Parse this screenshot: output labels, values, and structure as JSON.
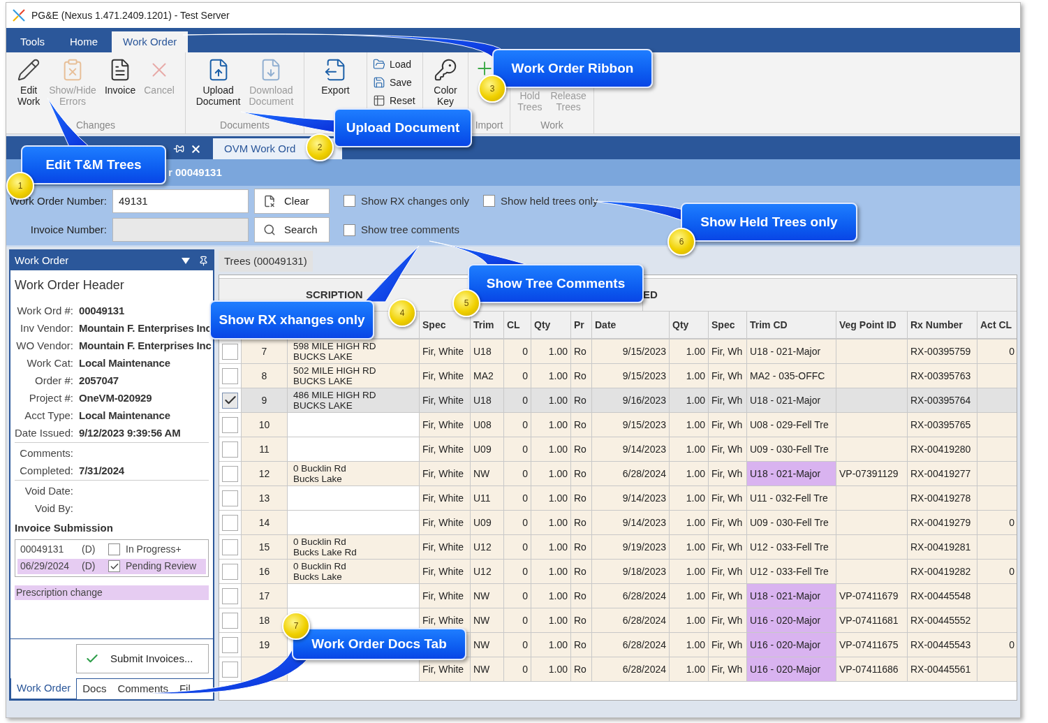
{
  "window": {
    "title": "PG&E (Nexus 1.471.2409.1201) - Test Server"
  },
  "ribbon_tabs": [
    {
      "label": "Tools",
      "selected": false
    },
    {
      "label": "Home",
      "selected": false
    },
    {
      "label": "Work Order",
      "selected": true
    }
  ],
  "ribbon_groups": [
    {
      "label": "Changes",
      "items": [
        {
          "kind": "large",
          "label": "Edit Work",
          "disabled": false
        },
        {
          "kind": "large",
          "label": "Show/Hide Errors",
          "disabled": true
        },
        {
          "kind": "large",
          "label": "Invoice",
          "disabled": false
        },
        {
          "kind": "large",
          "label": "Cancel",
          "disabled": true
        }
      ]
    },
    {
      "label": "Documents",
      "items": [
        {
          "kind": "large",
          "label": "Upload Document",
          "disabled": false
        },
        {
          "kind": "large",
          "label": "Download Document",
          "disabled": true
        }
      ]
    },
    {
      "items": [
        {
          "kind": "large",
          "label": "Export",
          "disabled": false
        }
      ]
    },
    {
      "items": [
        {
          "kind": "small",
          "label": "Load",
          "disabled": false
        },
        {
          "kind": "small",
          "label": "Save",
          "disabled": false
        },
        {
          "kind": "small",
          "label": "Reset",
          "disabled": false
        }
      ]
    },
    {
      "items": [
        {
          "kind": "large",
          "label": "Color Key",
          "disabled": false
        }
      ]
    },
    {
      "label": "Import",
      "items": [
        {
          "kind": "icon",
          "disabled": false
        }
      ]
    },
    {
      "label": "Work",
      "items": [
        {
          "kind": "large",
          "label": "Hold Trees",
          "disabled": true
        },
        {
          "kind": "large",
          "label": "Release Trees",
          "disabled": true
        }
      ]
    }
  ],
  "document_tabs": [
    {
      "selected": false
    },
    {
      "label": "OVM Work Ord",
      "selected": true
    }
  ],
  "page_header": {
    "title": "r 00049131"
  },
  "search": {
    "work_order_label": "Work Order Number:",
    "work_order_value": "49131",
    "invoice_label": "Invoice Number:",
    "clear_button": "Clear",
    "search_button": "Search",
    "options": [
      {
        "label": "Show RX changes only",
        "checked": false
      },
      {
        "label": "Show held trees only",
        "checked": false
      },
      {
        "label": "Show tree comments",
        "checked": false
      }
    ]
  },
  "left_panel": {
    "title": "Work Order",
    "section_title": "Work Order Header",
    "field_groups": [
      [
        {
          "label": "Work Ord #:",
          "value": "00049131"
        },
        {
          "label": "Inv Vendor:",
          "value": "Mountain F. Enterprises Inc"
        },
        {
          "label": "WO Vendor:",
          "value": "Mountain F. Enterprises Inc"
        },
        {
          "label": "Work Cat:",
          "value": "Local Maintenance"
        },
        {
          "label": "Order #:",
          "value": "2057047"
        },
        {
          "label": "Project #:",
          "value": "OneVM-020929"
        },
        {
          "label": "Acct Type:",
          "value": "Local Maintenance"
        },
        {
          "label": "Date Issued:",
          "value": "9/12/2023 9:39:56 AM"
        }
      ],
      [
        {
          "label": "Comments:"
        },
        {
          "label": "Completed:",
          "value": "7/31/2024"
        }
      ],
      [
        {
          "label": "Void Date:"
        },
        {
          "label": "Void By:"
        }
      ]
    ],
    "invoice_title": "Invoice Submission",
    "invoices": [
      {
        "number": "00049131",
        "code": "(D)",
        "checked": false,
        "status": "In Progress+",
        "highlighted": false
      },
      {
        "number": "06/29/2024",
        "code": "(D)",
        "checked": true,
        "status": "Pending Review",
        "highlighted": true
      }
    ],
    "note": {
      "text": "Prescription change",
      "highlighted": true
    },
    "submit_button": "Submit Invoices...",
    "bottom_tabs": [
      {
        "label": "Work Order",
        "selected": true
      },
      {
        "label": "Docs",
        "selected": false
      },
      {
        "label": "Comments",
        "selected": false
      },
      {
        "label": "Fil",
        "selected": false
      }
    ]
  },
  "grid": {
    "tab": {
      "label": "Trees (00049131)",
      "selected": true
    },
    "group_headers": [
      "SCRIPTION",
      "ED"
    ],
    "columns": [
      "Spec",
      "Trim",
      "CL",
      "Qty",
      "Pr",
      "Date",
      "Qty",
      "Spec",
      "Trim CD",
      "Veg Point ID",
      "Rx Number",
      "Act CL"
    ],
    "rows": [
      {
        "checked": false,
        "selected": false,
        "number": "7",
        "address": "598 MILE HIGH RD\nBUCKS LAKE",
        "spec": "Fir, White",
        "trim": "U18",
        "cl": "0",
        "qty": "1.00",
        "pr": "Ro",
        "date": "9/15/2023",
        "qty_2": "1.00",
        "spec_2": "Fir, Wh",
        "trim_cd": "U18 - 021-Major",
        "highlighted": false,
        "rx_number": "RX-00395759",
        "act_cl": "0"
      },
      {
        "checked": false,
        "selected": false,
        "number": "8",
        "address": "502 MILE HIGH RD\nBUCKS LAKE",
        "spec": "Fir, White",
        "trim": "MA2",
        "cl": "0",
        "qty": "1.00",
        "pr": "Ro",
        "date": "9/15/2023",
        "qty_2": "1.00",
        "spec_2": "Fir, Wh",
        "trim_cd": "MA2 - 035-OFFC",
        "highlighted": false,
        "rx_number": "RX-00395763"
      },
      {
        "checked": true,
        "selected": true,
        "number": "9",
        "address": "486 MILE HIGH RD\nBUCKS LAKE",
        "spec": "Fir, White",
        "trim": "U18",
        "cl": "0",
        "qty": "1.00",
        "pr": "Ro",
        "date": "9/16/2023",
        "qty_2": "1.00",
        "spec_2": "Fir, Wh",
        "trim_cd": "U18 - 021-Major",
        "highlighted": false,
        "rx_number": "RX-00395764"
      },
      {
        "checked": false,
        "selected": false,
        "number": "10",
        "spec": "Fir, White",
        "trim": "U08",
        "cl": "0",
        "qty": "1.00",
        "pr": "Ro",
        "date": "9/15/2023",
        "qty_2": "1.00",
        "spec_2": "Fir, Wh",
        "trim_cd": "U08 - 029-Fell Tre",
        "highlighted": false,
        "rx_number": "RX-00395765"
      },
      {
        "checked": false,
        "selected": false,
        "number": "11",
        "spec": "Fir, White",
        "trim": "U09",
        "cl": "0",
        "qty": "1.00",
        "pr": "Ro",
        "date": "9/14/2023",
        "qty_2": "1.00",
        "spec_2": "Fir, Wh",
        "trim_cd": "U09 - 030-Fell Tre",
        "highlighted": false,
        "rx_number": "RX-00419280"
      },
      {
        "checked": false,
        "selected": false,
        "number": "12",
        "address": "0 Bucklin Rd\nBucks Lake",
        "spec": "Fir, White",
        "trim": "NW",
        "cl": "0",
        "qty": "1.00",
        "pr": "Ro",
        "date": "6/28/2024",
        "qty_2": "1.00",
        "spec_2": "Fir, Wh",
        "trim_cd": "U18 - 021-Major",
        "highlighted": true,
        "veg_point_id": "VP-07391129",
        "rx_number": "RX-00419277"
      },
      {
        "checked": false,
        "selected": false,
        "number": "13",
        "spec": "Fir, White",
        "trim": "U11",
        "cl": "0",
        "qty": "1.00",
        "pr": "Ro",
        "date": "9/14/2023",
        "qty_2": "1.00",
        "spec_2": "Fir, Wh",
        "trim_cd": "U11 - 032-Fell Tre",
        "highlighted": false,
        "rx_number": "RX-00419278"
      },
      {
        "checked": false,
        "selected": false,
        "number": "14",
        "spec": "Fir, White",
        "trim": "U09",
        "cl": "0",
        "qty": "1.00",
        "pr": "Ro",
        "date": "9/14/2023",
        "qty_2": "1.00",
        "spec_2": "Fir, Wh",
        "trim_cd": "U09 - 030-Fell Tre",
        "highlighted": false,
        "rx_number": "RX-00419279",
        "act_cl": "0"
      },
      {
        "checked": false,
        "selected": false,
        "number": "15",
        "address": "0 Bucklin Rd\nBucks Lake Rd",
        "spec": "Fir, White",
        "trim": "U12",
        "cl": "0",
        "qty": "1.00",
        "pr": "Ro",
        "date": "9/19/2023",
        "qty_2": "1.00",
        "spec_2": "Fir, Wh",
        "trim_cd": "U12 - 033-Fell Tre",
        "highlighted": false,
        "rx_number": "RX-00419281"
      },
      {
        "checked": false,
        "selected": false,
        "number": "16",
        "address": "0 Bucklin Rd\nBucks Lake",
        "spec": "Fir, White",
        "trim": "U12",
        "cl": "0",
        "qty": "1.00",
        "pr": "Ro",
        "date": "9/18/2023",
        "qty_2": "1.00",
        "spec_2": "Fir, Wh",
        "trim_cd": "U12 - 033-Fell Tre",
        "highlighted": false,
        "rx_number": "RX-00419282",
        "act_cl": "0"
      },
      {
        "checked": false,
        "selected": false,
        "number": "17",
        "spec": "Fir, White",
        "trim": "NW",
        "cl": "0",
        "qty": "1.00",
        "pr": "Ro",
        "date": "6/28/2024",
        "qty_2": "1.00",
        "spec_2": "Fir, Wh",
        "trim_cd": "U18 - 021-Major",
        "highlighted": true,
        "veg_point_id": "VP-07411679",
        "rx_number": "RX-00445548"
      },
      {
        "checked": false,
        "selected": false,
        "number": "18",
        "spec": "Fir, White",
        "trim": "NW",
        "cl": "0",
        "qty": "1.00",
        "pr": "Ro",
        "date": "6/28/2024",
        "qty_2": "1.00",
        "spec_2": "Fir, Wh",
        "trim_cd": "U16 - 020-Major",
        "highlighted": true,
        "veg_point_id": "VP-07411681",
        "rx_number": "RX-00445552"
      },
      {
        "checked": false,
        "selected": false,
        "number": "19",
        "trim": "NW",
        "cl": "0",
        "qty": "1.00",
        "pr": "Ro",
        "date": "6/28/2024",
        "qty_2": "1.00",
        "spec_2": "Fir, Wh",
        "trim_cd": "U16 - 020-Major",
        "highlighted": true,
        "veg_point_id": "VP-07411675",
        "rx_number": "RX-00445543",
        "act_cl": "0"
      },
      {
        "checked": false,
        "selected": false,
        "spec": "Fir, White",
        "trim": "NW",
        "cl": "0",
        "qty": "1.00",
        "pr": "Ro",
        "date": "6/28/2024",
        "qty_2": "1.00",
        "spec_2": "Fir, Wh",
        "trim_cd": "U16 - 020-Major",
        "highlighted": true,
        "veg_point_id": "VP-07411686",
        "rx_number": "RX-00445561"
      }
    ]
  },
  "callouts": [
    {
      "number": "1",
      "label": "Edit T&M Trees"
    },
    {
      "number": "2",
      "label": "Upload Document"
    },
    {
      "number": "3",
      "label": "Work Order Ribbon"
    },
    {
      "number": "4",
      "label": "Show RX xhanges only"
    },
    {
      "number": "5",
      "label": "Show Tree Comments"
    },
    {
      "number": "6",
      "label": "Show Held Trees only"
    },
    {
      "number": "7",
      "label": "Work Order Docs Tab"
    }
  ]
}
